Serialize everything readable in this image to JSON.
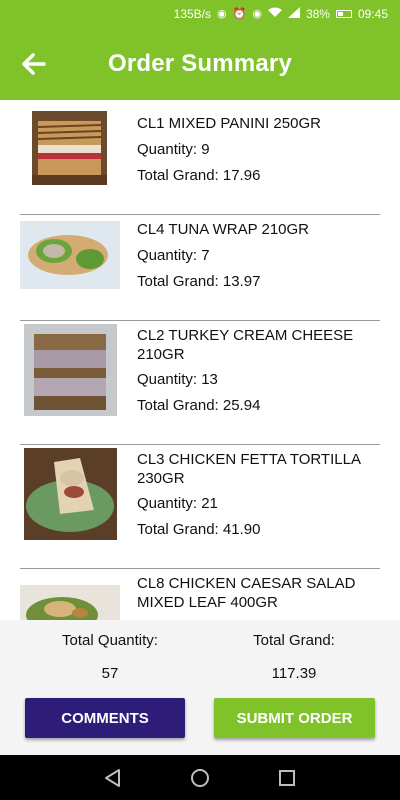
{
  "status_bar": {
    "speed": "135B/s",
    "battery_percent": "38%",
    "time": "09:45"
  },
  "header": {
    "title": "Order Summary",
    "back_icon": "arrow-left-icon"
  },
  "items": [
    {
      "name": "CL1 MIXED PANINI 250GR",
      "quantity": "Quantity: 9",
      "total": "Total Grand: 17.96",
      "image": "panini-photo"
    },
    {
      "name": "CL4 TUNA WRAP 210GR",
      "quantity": "Quantity: 7",
      "total": "Total Grand: 13.97",
      "image": "tuna-wrap-photo"
    },
    {
      "name": "CL2 TURKEY CREAM CHEESE 210GR",
      "quantity": "Quantity: 13",
      "total": "Total Grand: 25.94",
      "image": "turkey-sandwich-photo"
    },
    {
      "name": "CL3 CHICKEN  FETTA TORTILLA 230GR",
      "quantity": "Quantity: 21",
      "total": "Total Grand: 41.90",
      "image": "chicken-tortilla-photo"
    },
    {
      "name": "CL8 CHICKEN CAESAR SALAD MIXED LEAF 400GR",
      "quantity": "",
      "total": "",
      "image": "caesar-salad-photo"
    }
  ],
  "summary": {
    "total_quantity_label": "Total Quantity:",
    "total_quantity_value": "57",
    "total_grand_label": "Total Grand:",
    "total_grand_value": "117.39"
  },
  "buttons": {
    "comments": "COMMENTS",
    "submit": "SUBMIT ORDER"
  },
  "colors": {
    "brand_green": "#80c22a",
    "comments_button": "#2e1d78",
    "nav_bar": "#000000"
  }
}
